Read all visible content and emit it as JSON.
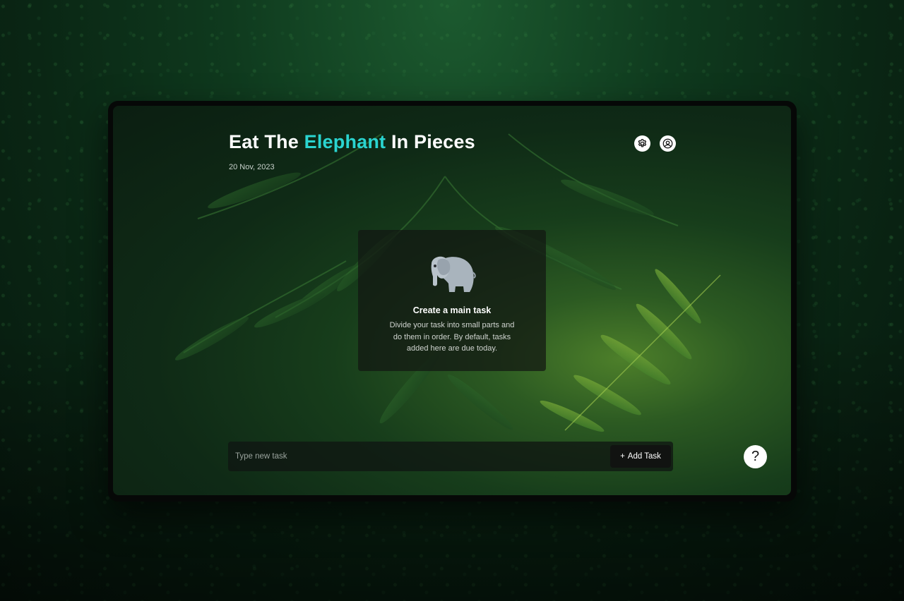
{
  "app": {
    "title_before": "Eat The ",
    "title_accent": "Elephant",
    "title_after": " In Pieces",
    "date": "20 Nov, 2023",
    "accent_color": "#2ad4d0"
  },
  "header_icons": {
    "settings": "gear-icon",
    "profile": "user-circle-icon"
  },
  "empty_state": {
    "icon": "elephant-icon",
    "title": "Create a main task",
    "description": "Divide your task into small parts and do them in order.  By default, tasks added here are due today."
  },
  "task_input": {
    "placeholder": "Type new task",
    "value": ""
  },
  "add_button": {
    "icon": "plus",
    "label": "Add Task"
  },
  "help_button": {
    "label": "?"
  }
}
